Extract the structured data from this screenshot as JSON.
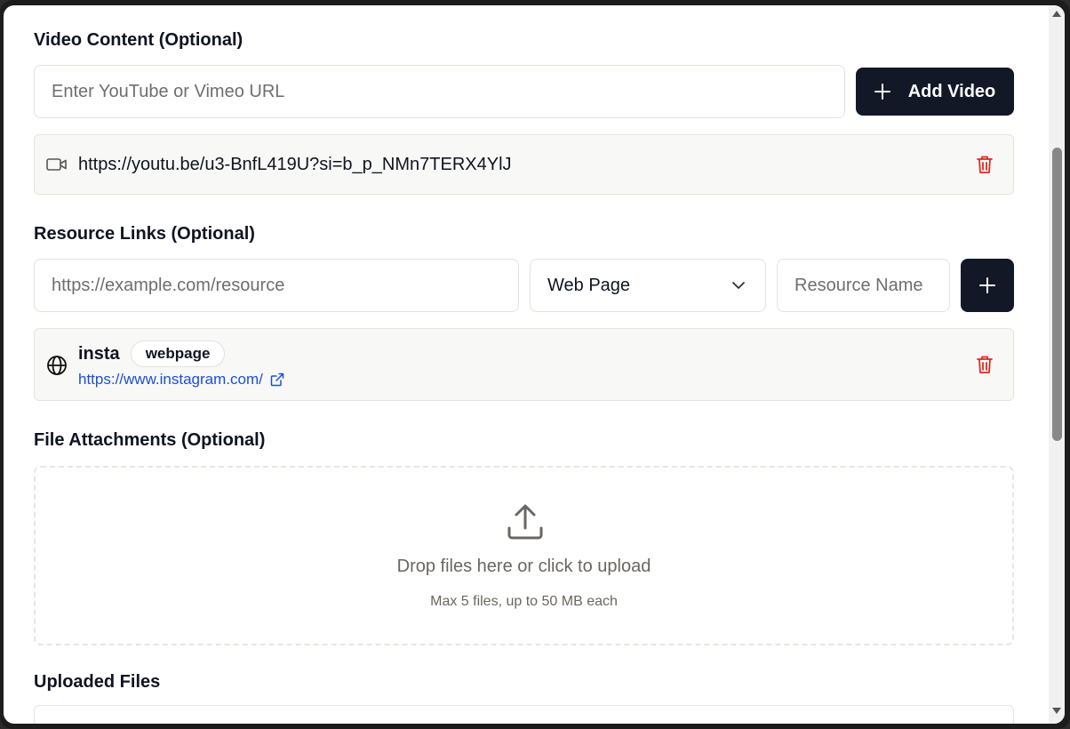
{
  "video": {
    "title": "Video Content (Optional)",
    "input_placeholder": "Enter YouTube or Vimeo URL",
    "add_label": "Add Video",
    "items": [
      {
        "url": "https://youtu.be/u3-BnfL419U?si=b_p_NMn7TERX4YlJ",
        "icon": "video-icon"
      }
    ]
  },
  "resources": {
    "title": "Resource Links (Optional)",
    "url_placeholder": "https://example.com/resource",
    "type_selected": "Web Page",
    "name_placeholder": "Resource Name",
    "items": [
      {
        "name": "insta",
        "type": "webpage",
        "url": "https://www.instagram.com/",
        "icon": "globe-icon"
      }
    ]
  },
  "attachments": {
    "title": "File Attachments (Optional)",
    "drop_text": "Drop files here or click to upload",
    "limit_text": "Max 5 files, up to 50 MB each"
  },
  "uploaded": {
    "title": "Uploaded Files"
  },
  "colors": {
    "primary": "#121826",
    "danger": "#d92d20",
    "link": "#1d4ed8",
    "card_bg": "#f8f8f6"
  }
}
